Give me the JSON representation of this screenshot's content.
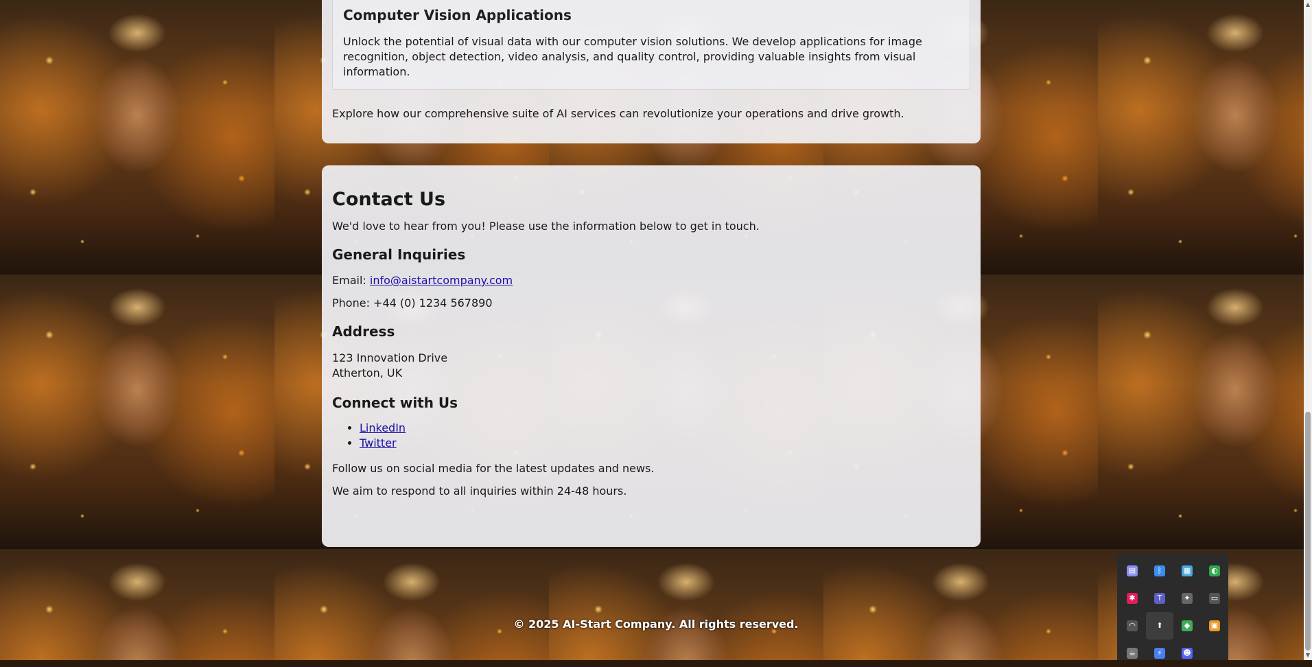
{
  "services": {
    "card_title": "Computer Vision Applications",
    "card_text": "Unlock the potential of visual data with our computer vision solutions. We develop applications for image recognition, object detection, video analysis, and quality control, providing valuable insights from visual information.",
    "explore_text": "Explore how our comprehensive suite of AI services can revolutionize your operations and drive growth."
  },
  "contact": {
    "title": "Contact Us",
    "intro": "We'd love to hear from you! Please use the information below to get in touch.",
    "general_heading": "General Inquiries",
    "email_label": "Email:",
    "email_value": "info@aistartcompany.com",
    "phone_text": "Phone: +44 (0) 1234 567890",
    "address_heading": "Address",
    "address_line1": "123 Innovation Drive",
    "address_line2": "Atherton, UK",
    "connect_heading": "Connect with Us",
    "social_links": [
      "LinkedIn",
      "Twitter"
    ],
    "follow_text": "Follow us on social media for the latest updates and news.",
    "response_text": "We aim to respond to all inquiries within 24-48 hours."
  },
  "footer": {
    "copyright": "© 2025 AI-Start Company. All rights reserved."
  },
  "tray": {
    "icons": [
      {
        "name": "chat-icon",
        "color": "#8a8ff0",
        "glyph": "▤"
      },
      {
        "name": "bluetooth-icon",
        "color": "#3a8ef0",
        "glyph": "ᛒ"
      },
      {
        "name": "network-monitor-icon",
        "color": "#4aa8e0",
        "glyph": "▦"
      },
      {
        "name": "shield-app-icon",
        "color": "#2fa84f",
        "glyph": "◐"
      },
      {
        "name": "slack-icon",
        "color": "#e01e5a",
        "glyph": "✱"
      },
      {
        "name": "teams-icon",
        "color": "#5b5fc7",
        "glyph": "T"
      },
      {
        "name": "ai-assistant-icon",
        "color": "#666666",
        "glyph": "✦"
      },
      {
        "name": "battery-icon",
        "color": "#555555",
        "glyph": "▭"
      },
      {
        "name": "wifi-icon",
        "color": "#555555",
        "glyph": "◠"
      },
      {
        "name": "bookmark-app-icon",
        "color": "#ffffff",
        "glyph": "⬆",
        "active": true
      },
      {
        "name": "layers-app-icon",
        "color": "#3fae5a",
        "glyph": "◆"
      },
      {
        "name": "color-palette-icon",
        "color": "#e89a2a",
        "glyph": "▣"
      },
      {
        "name": "cup-icon",
        "color": "#777777",
        "glyph": "☕"
      },
      {
        "name": "bolt-app-icon",
        "color": "#4a7ff0",
        "glyph": "⚡"
      },
      {
        "name": "discord-icon",
        "color": "#5865f2",
        "glyph": "☻"
      }
    ]
  }
}
